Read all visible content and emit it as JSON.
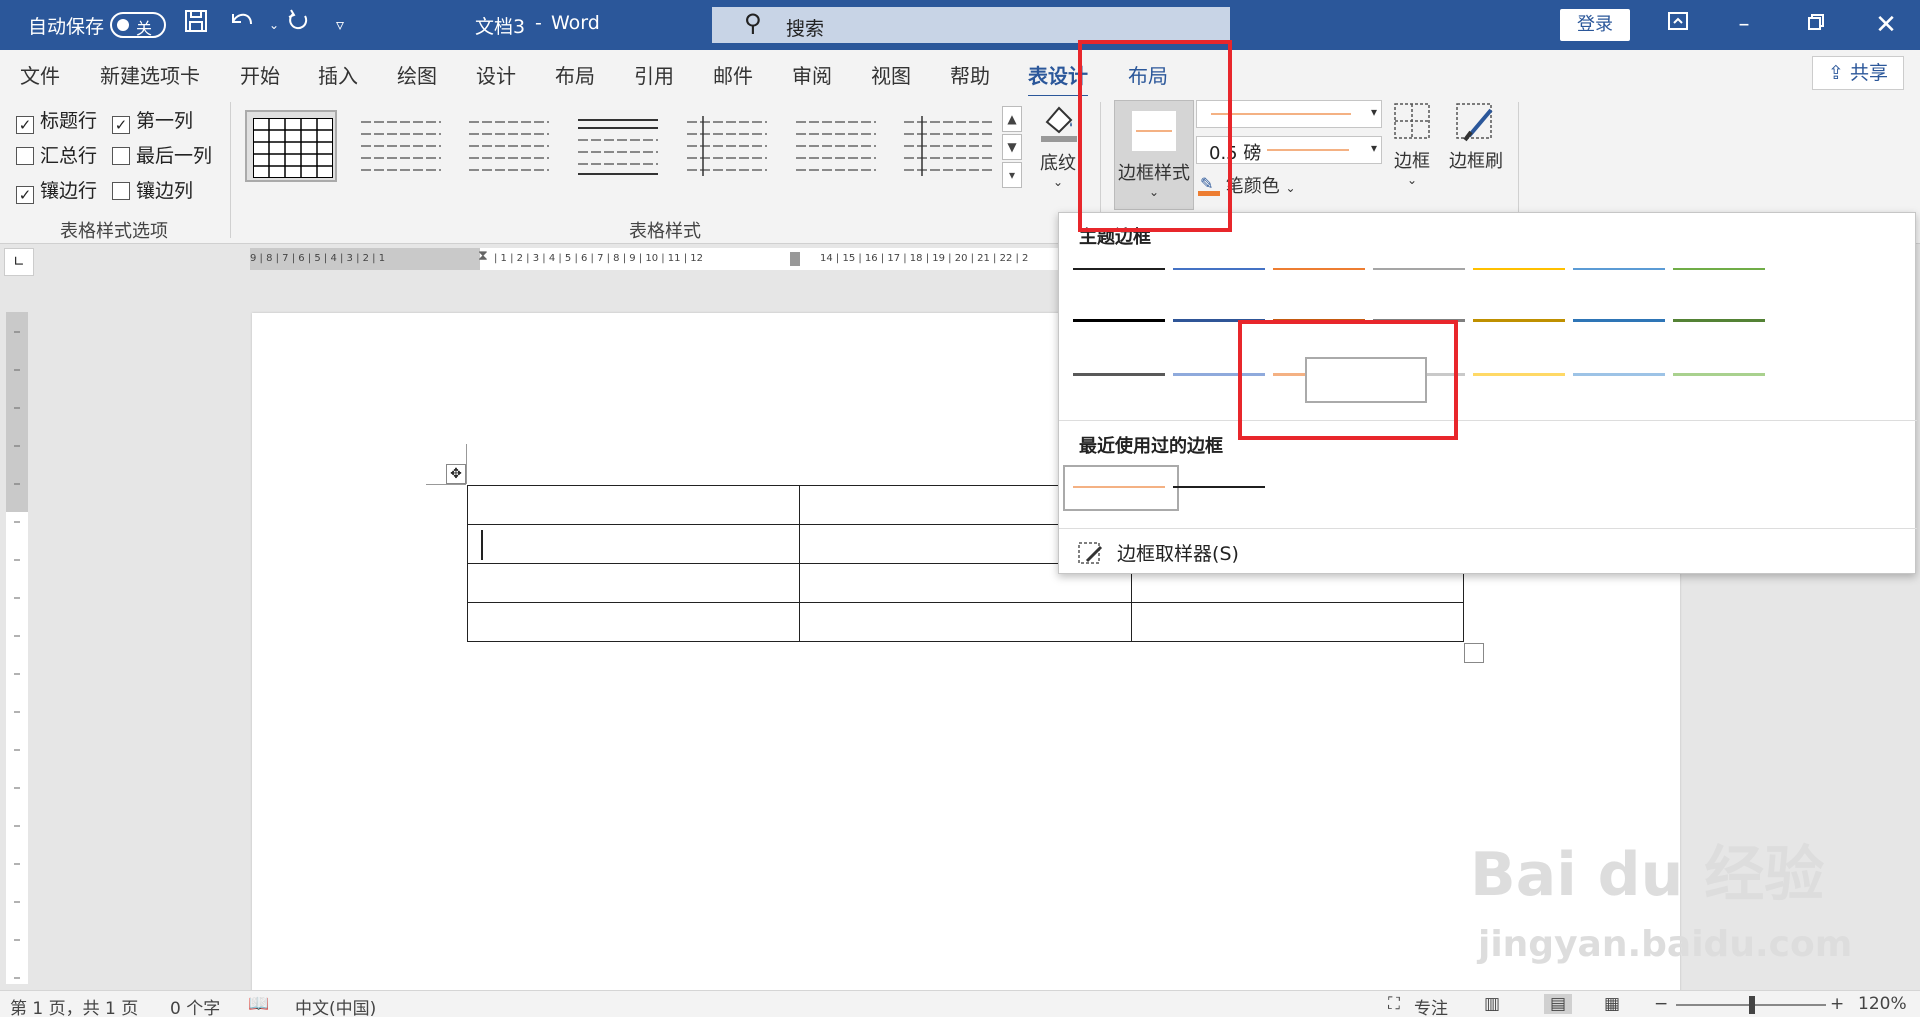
{
  "title_bar": {
    "autosave_label": "自动保存",
    "autosave_state": "关",
    "doc_title": "文档3",
    "title_sep": "-",
    "app_name": "Word",
    "search_placeholder": "搜索",
    "login_label": "登录",
    "icons": [
      "save-icon",
      "undo-icon",
      "redo-icon",
      "customize-qat-icon",
      "search-icon",
      "ribbon-display-icon",
      "minimize-icon",
      "restore-icon",
      "close-icon"
    ]
  },
  "tabs": [
    {
      "label": "文件"
    },
    {
      "label": "新建选项卡"
    },
    {
      "label": "开始"
    },
    {
      "label": "插入"
    },
    {
      "label": "绘图"
    },
    {
      "label": "设计"
    },
    {
      "label": "布局"
    },
    {
      "label": "引用"
    },
    {
      "label": "邮件"
    },
    {
      "label": "审阅"
    },
    {
      "label": "视图"
    },
    {
      "label": "帮助"
    },
    {
      "label": "表设计",
      "active": true
    },
    {
      "label": "布局"
    }
  ],
  "share_label": "共享",
  "style_options": {
    "items": [
      {
        "label": "标题行",
        "checked": true
      },
      {
        "label": "第一列",
        "checked": true
      },
      {
        "label": "汇总行",
        "checked": false
      },
      {
        "label": "最后一列",
        "checked": false
      },
      {
        "label": "镶边行",
        "checked": true
      },
      {
        "label": "镶边列",
        "checked": false
      }
    ],
    "group_label": "表格样式选项"
  },
  "table_styles": {
    "group_label": "表格样式"
  },
  "shading_label": "底纹",
  "border_style_label": "边框样式",
  "pen_weight_value": "0.5 磅",
  "pen_color_label": "笔颜色",
  "borders_label": "边框",
  "border_painter_label": "边框刷",
  "ruler": {
    "h_left": "9 | 8 | 7 | 6 | 5 | 4 | 3 | 2 | 1",
    "h_right": "| 1 | 2 | 3 | 4 | 5 | 6 | 7 | 8 | 9 | 10 | 11 | 12",
    "h_far": "14 | 15 | 16 | 17 | 18 | 19 | 20 | 21 | 22 | 2"
  },
  "dropdown": {
    "theme_header": "主题边框",
    "recent_header": "最近使用过的边框",
    "picker_label": "边框取样器(S)",
    "rows": [
      [
        "#1f1f1f",
        "#4472c4",
        "#ed7d31",
        "#a5a5a5",
        "#ffc000",
        "#5b9bd5",
        "#70ad47"
      ],
      [
        "#000000",
        "#2f5597",
        "#c55a11",
        "#7f7f7f",
        "#bf9000",
        "#2e75b6",
        "#548235"
      ],
      [
        "#595959",
        "#8faadc",
        "#f4b183",
        "#c9c9c9",
        "#ffd966",
        "#9dc3e6",
        "#a9d18e"
      ]
    ],
    "recent": [
      "#f4b183",
      "#1f1f1f"
    ]
  },
  "status": {
    "page": "第 1 页，共 1 页",
    "words": "0 个字",
    "language": "中文(中国)",
    "focus": "专注",
    "zoom": "120%",
    "zoom_minus": "−",
    "zoom_plus": "+"
  },
  "watermark": {
    "brand": "Bai du 经验",
    "url": "jingyan.baidu.com"
  }
}
